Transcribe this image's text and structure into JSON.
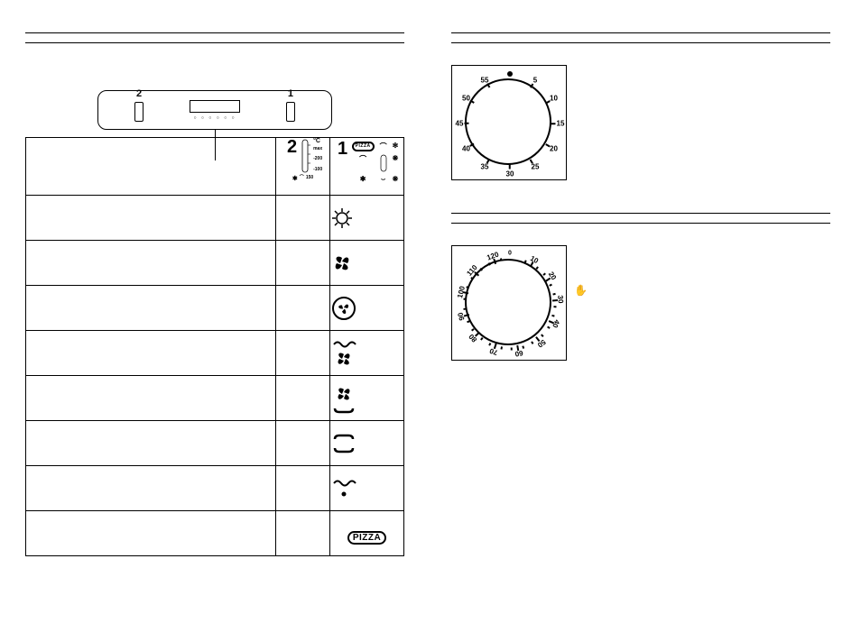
{
  "left": {
    "panel": {
      "label_left": "2",
      "label_right": "1"
    },
    "table": {
      "header2_num": "2",
      "header2_unit": "°C",
      "header2_scale": [
        "max",
        "200",
        "100",
        "150"
      ],
      "header1_num": "1",
      "header1_icons": [
        "pizza",
        "light",
        "fan",
        "conv",
        "brackets",
        "fan-bracket"
      ],
      "rows": [
        {
          "icon": "light"
        },
        {
          "icon": "fan-solid"
        },
        {
          "icon": "fan-circle"
        },
        {
          "icon": "wave-fan"
        },
        {
          "icon": "fan-bracket"
        },
        {
          "icon": "brackets"
        },
        {
          "icon": "wave-dot"
        },
        {
          "icon": "pizza"
        }
      ]
    }
  },
  "right": {
    "dial1": {
      "numbers": [
        "5",
        "10",
        "15",
        "20",
        "25",
        "30",
        "35",
        "40",
        "45",
        "50",
        "55"
      ]
    },
    "dial2": {
      "numbers": [
        "10",
        "20",
        "30",
        "40",
        "50",
        "60",
        "70",
        "80",
        "90",
        "100",
        "110",
        "120"
      ],
      "hand_symbol": "✋"
    }
  }
}
